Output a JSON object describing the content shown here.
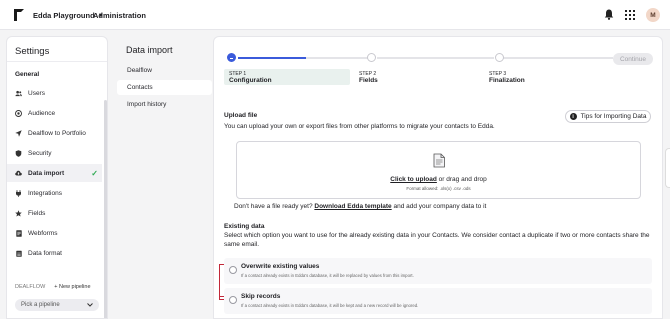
{
  "header": {
    "workspace": "Edda Playground",
    "breadcrumb": "Administration",
    "avatar_initial": "M"
  },
  "settings": {
    "title": "Settings",
    "group_label": "General",
    "items": [
      {
        "label": "Users",
        "icon": "users-icon"
      },
      {
        "label": "Audience",
        "icon": "target-icon"
      },
      {
        "label": "Dealflow to Portfolio",
        "icon": "send-icon"
      },
      {
        "label": "Security",
        "icon": "shield-icon"
      },
      {
        "label": "Data import",
        "icon": "cloud-upload-icon",
        "active": true
      },
      {
        "label": "Integrations",
        "icon": "plug-icon"
      },
      {
        "label": "Fields",
        "icon": "star-icon"
      },
      {
        "label": "Webforms",
        "icon": "document-icon"
      },
      {
        "label": "Data format",
        "icon": "calendar-icon"
      }
    ],
    "dealflow_label": "DEALFLOW",
    "new_pipeline": "New pipeline",
    "pick_pipeline": "Pick a pipeline"
  },
  "subnav": {
    "title": "Data import",
    "items": [
      {
        "label": "Dealflow"
      },
      {
        "label": "Contacts",
        "active": true
      },
      {
        "label": "Import history"
      }
    ]
  },
  "main": {
    "steps": [
      {
        "num": "STEP 1",
        "name": "Configuration",
        "current": true
      },
      {
        "num": "STEP 2",
        "name": "Fields"
      },
      {
        "num": "STEP 3",
        "name": "Finalization"
      }
    ],
    "continue_label": "Continue",
    "upload_title": "Upload file",
    "upload_desc": "You can upload your own or export files from other platforms to migrate your contacts to Edda.",
    "tips_label": "Tips for Importing Data",
    "drop_link": "Click to upload",
    "drop_text": " or drag and drop",
    "drop_formats": "Format allowed: .xls(x) .csv .ods",
    "template_pre": "Don't have a file ready yet? ",
    "template_link": "Download Edda template",
    "template_post": " and add your company data to it",
    "existing_title": "Existing data",
    "existing_desc": "Select which option you want to use for the already existing data in your Contacts. We consider contact a duplicate if two or more contacts share the same email.",
    "options": [
      {
        "title": "Overwrite existing values",
        "desc": "If a contact already exists in Edda's database, it will be replaced by values from this import."
      },
      {
        "title": "Skip records",
        "desc": "If a contact already exists in Edda's database, it will be kept and a new record will be ignored."
      }
    ]
  },
  "colors": {
    "accent": "#3b5bdb",
    "check": "#2faa53",
    "highlight_bracket": "#c2283a"
  }
}
